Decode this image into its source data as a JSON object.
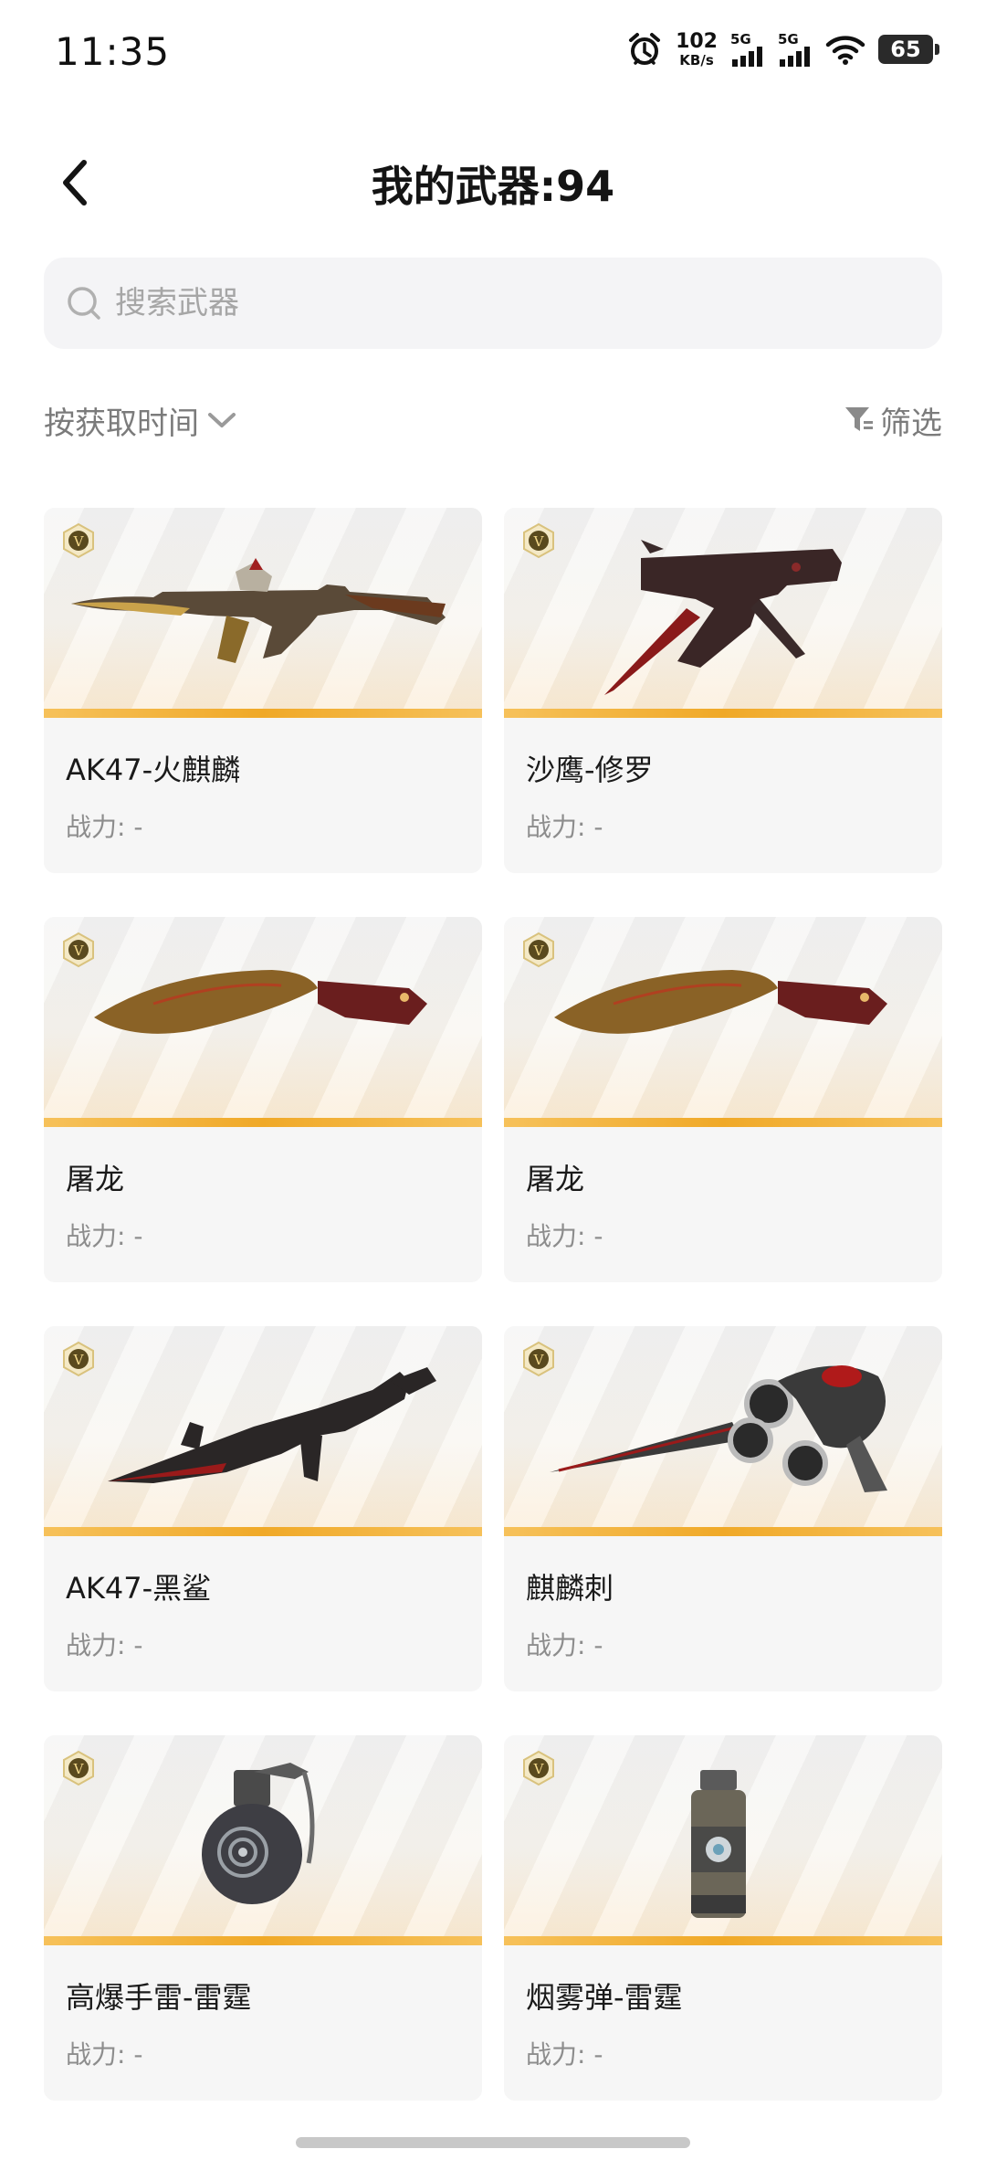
{
  "status_bar": {
    "time": "11:35",
    "speed_value": "102",
    "speed_unit": "KB/s",
    "signal1": "5G",
    "signal2": "5G",
    "battery": "65"
  },
  "header": {
    "title": "我的武器:94"
  },
  "search": {
    "placeholder": "搜索武器"
  },
  "sort": {
    "label": "按获取时间"
  },
  "filter": {
    "label": "筛选"
  },
  "weapons": [
    {
      "name": "AK47-火麒麟",
      "power_label": "战力: -"
    },
    {
      "name": "沙鹰-修罗",
      "power_label": "战力: -"
    },
    {
      "name": "屠龙",
      "power_label": "战力: -"
    },
    {
      "name": "屠龙",
      "power_label": "战力: -"
    },
    {
      "name": "AK47-黑鲨",
      "power_label": "战力: -"
    },
    {
      "name": "麒麟刺",
      "power_label": "战力: -"
    },
    {
      "name": "高爆手雷-雷霆",
      "power_label": "战力: -"
    },
    {
      "name": "烟雾弹-雷霆",
      "power_label": "战力: -"
    }
  ],
  "colors": {
    "accent_bar": "#f0a928",
    "card_bg": "#f6f6f6",
    "search_bg": "#f4f4f6"
  },
  "icons": [
    "alarm-icon",
    "signal-icon",
    "wifi-icon",
    "battery-icon",
    "back-icon",
    "search-icon",
    "chevron-down-icon",
    "filter-icon",
    "vip-badge-icon"
  ]
}
